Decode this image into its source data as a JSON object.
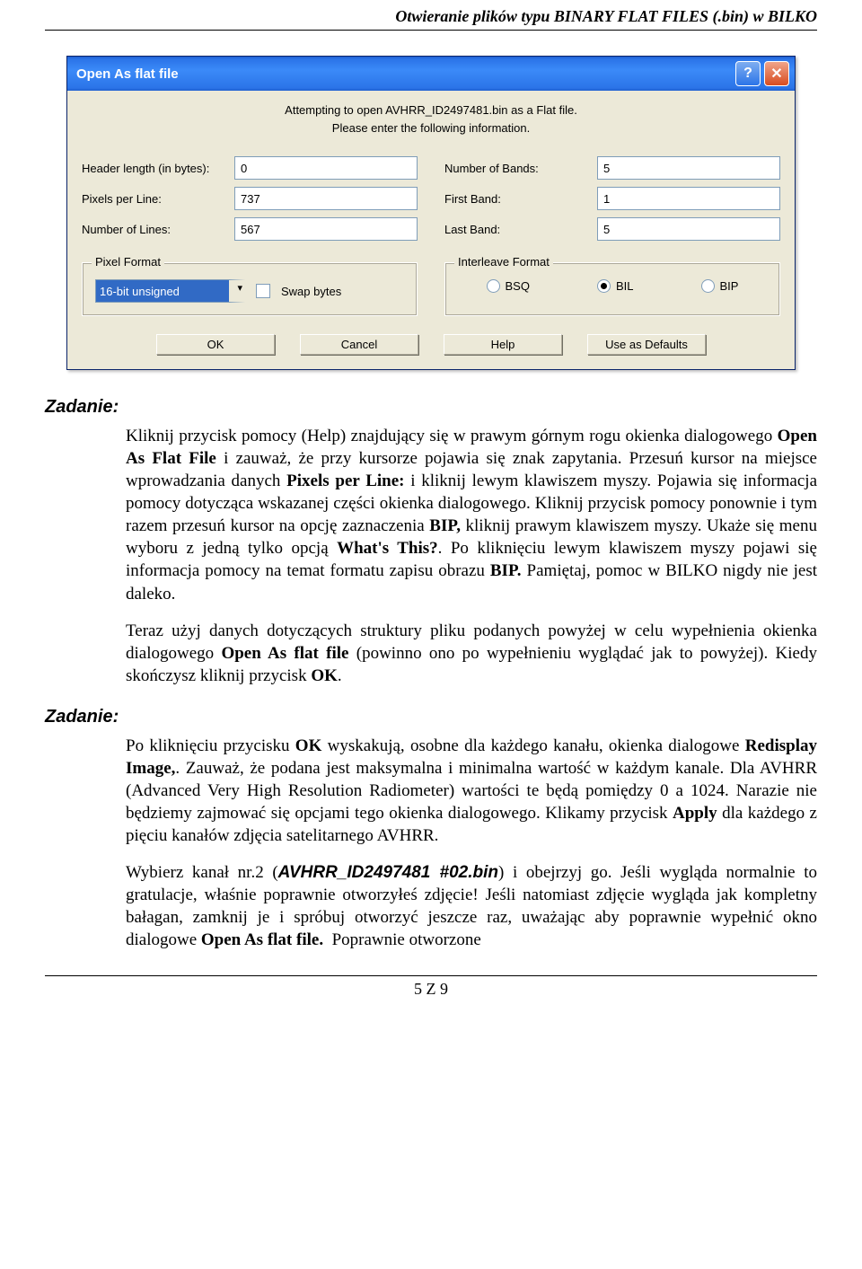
{
  "header": "Otwieranie plików typu BINARY FLAT FILES (.bin) w BILKO",
  "dialog": {
    "title": "Open As flat file",
    "intro_line1": "Attempting to open AVHRR_ID2497481.bin as a Flat file.",
    "intro_line2": "Please enter the following information.",
    "left": {
      "header_len_label": "Header length (in bytes):",
      "header_len_value": "0",
      "ppl_label": "Pixels per Line:",
      "ppl_value": "737",
      "nlines_label": "Number of Lines:",
      "nlines_value": "567"
    },
    "right": {
      "nbands_label": "Number of Bands:",
      "nbands_value": "5",
      "first_label": "First Band:",
      "first_value": "1",
      "last_label": "Last Band:",
      "last_value": "5"
    },
    "pixel_format": {
      "legend": "Pixel Format",
      "select_value": "16-bit unsigned",
      "swap_label": "Swap bytes"
    },
    "interleave": {
      "legend": "Interleave Format",
      "bsq": "BSQ",
      "bil": "BIL",
      "bip": "BIP"
    },
    "buttons": {
      "ok": "OK",
      "cancel": "Cancel",
      "help": "Help",
      "defaults": "Use as Defaults"
    }
  },
  "sections": {
    "label": "Zadanie:"
  },
  "p1": "Kliknij przycisk pomocy (Help) znajdujący się w prawym górnym rogu okienka dialogowego Open As Flat File i zauważ, że przy kursorze pojawia się znak zapytania. Przesuń kursor na miejsce wprowadzania danych Pixels per Line: i kliknij lewym klawiszem myszy. Pojawia się informacja pomocy dotycząca wskazanej części okienka dialogowego. Kliknij przycisk pomocy ponownie i tym razem przesuń kursor na opcję zaznaczenia BIP, kliknij prawym klawiszem myszy. Ukaże się menu wyboru z jedną tylko opcją What's This?. Po kliknięciu lewym klawiszem myszy pojawi się informacja pomocy na temat formatu zapisu obrazu BIP. Pamiętaj, pomoc w BILKO nigdy nie jest daleko.",
  "p2": "Teraz użyj danych dotyczących struktury pliku podanych powyżej w celu wypełnienia okienka dialogowego Open As flat file (powinno ono po wypełnieniu wyglądać jak to powyżej). Kiedy skończysz kliknij przycisk OK.",
  "p3": "Po kliknięciu przycisku OK wyskakują, osobne dla każdego kanału, okienka dialogowe Redisplay Image,. Zauważ, że podana jest maksymalna i minimalna wartość w każdym kanale. Dla AVHRR (Advanced Very High Resolution Radiometer) wartości te będą pomiędzy 0 a 1024. Narazie nie będziemy zajmować się opcjami tego okienka dialogowego. Klikamy przycisk Apply dla każdego z pięciu kanałów zdjęcia satelitarnego AVHRR.",
  "p4a": "Wybierz kanał nr.2 (",
  "p4file": "AVHRR_ID2497481 #02.bin",
  "p4b": ") i obejrzyj go. Jeśli wygląda normalnie to gratulacje, właśnie poprawnie otworzyłeś zdjęcie! Jeśli natomiast zdjęcie wygląda jak kompletny bałagan, zamknij je i spróbuj otworzyć jeszcze raz, uważając aby poprawnie wypełnić okno dialogowe Open As flat file.  Poprawnie otworzone",
  "footer": "5 Z 9"
}
